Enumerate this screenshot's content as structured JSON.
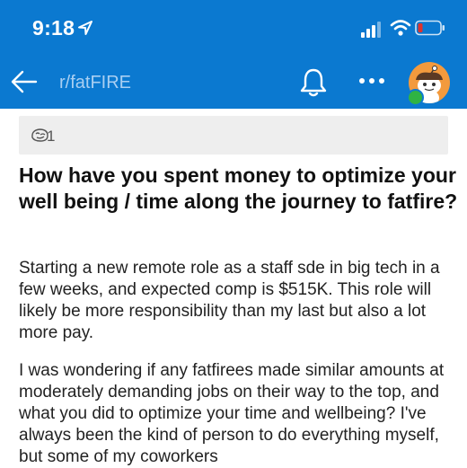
{
  "status_bar": {
    "time": "9:18",
    "icons": [
      "location-arrow-icon",
      "signal-bars-icon",
      "wifi-icon",
      "battery-low-icon"
    ]
  },
  "nav": {
    "back_icon": "back-arrow-icon",
    "subreddit": "r/fatFIRE",
    "bell_icon": "bell-icon",
    "more_icon": "more-horizontal-icon",
    "avatar": "snoo-avatar"
  },
  "post": {
    "flair_count": "1",
    "title": "How have you spent money to optimize your well being / time along the journey to fatfire?",
    "body": [
      "Starting a new remote role as a staff sde in big tech in a few weeks, and expected comp is $515K. This role will likely be more responsibility than my last but also a lot more pay.",
      "I was wondering if any fatfirees made similar amounts at moderately demanding jobs on their way to the top, and what you did to optimize your time and wellbeing? I've always been the kind of person to do everything myself, but some of my coworkers"
    ]
  },
  "colors": {
    "header_blue": "#0b79d0",
    "subreddit_text": "#a9cff2",
    "battery_low": "#e0322c",
    "avatar_orange": "#f39a3d",
    "online_green": "#2fb344"
  }
}
